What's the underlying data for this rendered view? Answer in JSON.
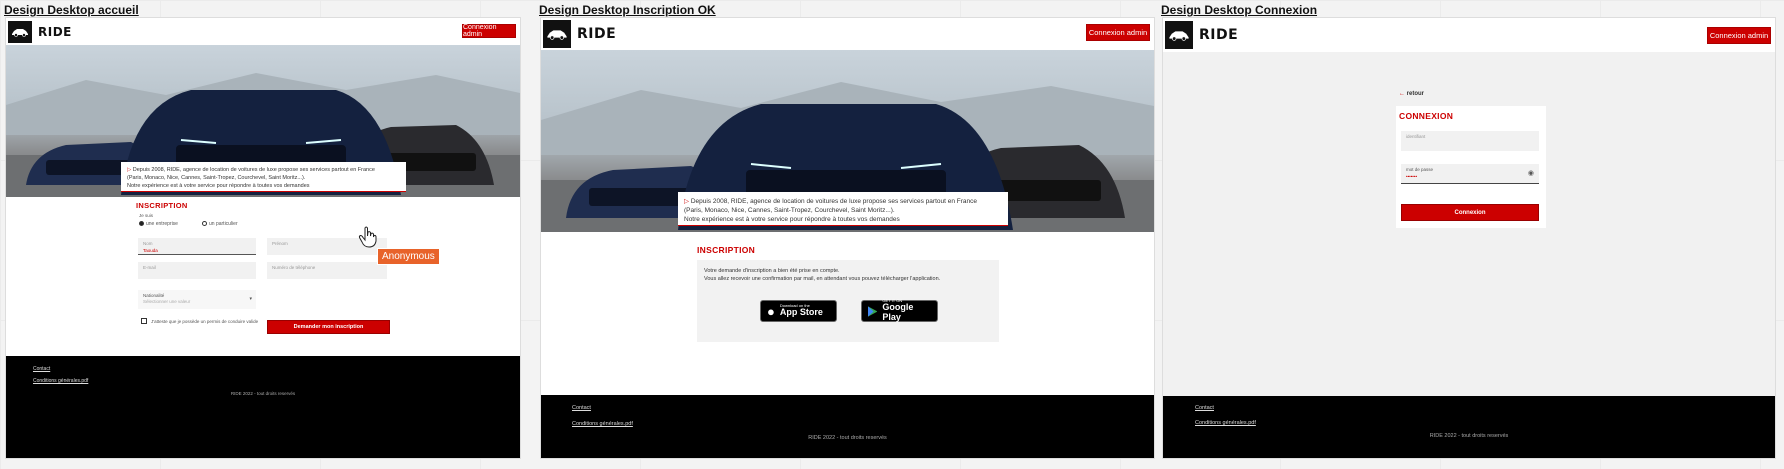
{
  "frames": {
    "home": {
      "title": "Design Desktop accueil"
    },
    "signup_ok": {
      "title": "Design Desktop Inscription OK"
    },
    "login": {
      "title": "Design Desktop Connexion"
    }
  },
  "brand": {
    "name": "RIDE"
  },
  "header": {
    "admin_button": "Connexion admin"
  },
  "intro": {
    "line1": "Depuis 2008, RIDE, agence de location de voitures de luxe propose ses services partout en France",
    "line2": "(Paris, Monaco, Nice, Cannes, Saint-Tropez, Courchevel, Saint Moritz...).",
    "line3": "Notre expérience est à votre service pour répondre à toutes vos demandes"
  },
  "signup_form": {
    "title": "INSCRIPTION",
    "je_suis": "Je suis",
    "radio_company": "une entreprise",
    "radio_private": "un particulier",
    "name_label": "Nom",
    "name_value": "Taouda",
    "surname_label": "Prénom",
    "email_label": "E-mail",
    "phone_label": "Numéro de téléphone",
    "nationality_label": "Nationalité",
    "nationality_placeholder": "Sélectionner une valeur",
    "license_checkbox": "J'atteste que je possède un permis de conduire valide",
    "submit": "Demander mon inscription"
  },
  "cursor_tag": "Anonymous",
  "signup_ok": {
    "title": "INSCRIPTION",
    "message_line1": "Votre demande d'inscription a bien été prise en compte.",
    "message_line2": "Vous allez recevoir une confirmation par mail, en attendant vous pouvez télécharger l'application.",
    "app_store_sub": "Download on the",
    "app_store_main": "App Store",
    "google_play_sub": "GET IT ON",
    "google_play_main": "Google Play"
  },
  "login": {
    "back": "retour",
    "title": "CONNEXION",
    "identifier_placeholder": "identifiant",
    "password_label": "mot de passe",
    "password_value": "•••••••",
    "submit": "Connexion"
  },
  "footer": {
    "contact": "Contact",
    "terms": "Conditions générales.pdf",
    "copyright": "RIDE 2022 - tout droits reservés"
  },
  "colors": {
    "accent": "#cc0000",
    "footer": "#000000"
  }
}
